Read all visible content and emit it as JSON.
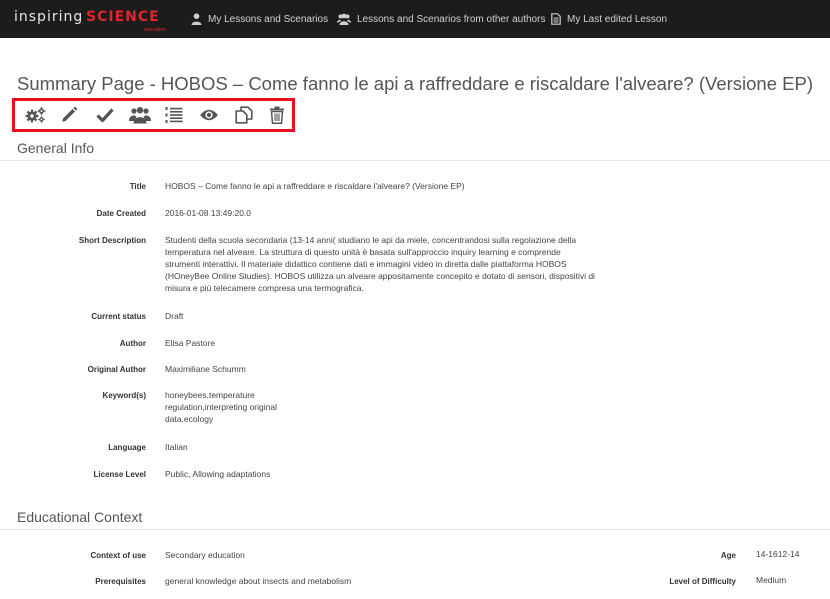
{
  "brand": {
    "word1": "inspiring",
    "word2": "SCIENCE",
    "tagline": "education"
  },
  "nav": [
    {
      "label": "My Lessons and Scenarios",
      "icon": "user-icon"
    },
    {
      "label": "Lessons and Scenarios from other authors",
      "icon": "users-icon"
    },
    {
      "label": "My Last edited Lesson",
      "icon": "document-icon"
    }
  ],
  "page_title": "Summary Page - HOBOS – Come fanno le api a raffreddare e riscaldare l'alveare? (Versione EP)",
  "toolbar": {
    "highlight_color": "#e8101c",
    "icons": [
      "settings-gears-icon",
      "pencil-edit-icon",
      "checkmark-icon",
      "users-group-icon",
      "numbered-list-icon",
      "eye-preview-icon",
      "copy-icon",
      "trash-icon"
    ]
  },
  "general_info": {
    "title": "General Info",
    "fields": [
      {
        "label": "Title",
        "value": "HOBOS – Come fanno le api a raffreddare e riscaldare l'alveare? (Versione EP)"
      },
      {
        "label": "Date Created",
        "value": "2016-01-08 13:49:20.0"
      },
      {
        "label": "Short Description",
        "value": "Studenti della scuola secondaria (13-14 anni( studiano le api da miele, concentrandosi sulla regolazione della temperatura nel alveare. La struttura di questo unità è basata sull'approccio inquiry learning e comprende strumenti interattivi. Il materiale didattico contiene dati e immagini video in diretta dalle piattaforma HOBOS (HOneyBee Online Studies). HOBOS utilizza un alveare appositamente concepito e dotato di sensori, dispositivi di misura e più telecamere compresa una termografica."
      },
      {
        "label": "Current status",
        "value": "Draft"
      },
      {
        "label": "Author",
        "value": "Elisa Pastore"
      },
      {
        "label": "Original Author",
        "value": "Maximiliane Schumm"
      },
      {
        "label": "Keyword(s)",
        "value": "honeybees,temperature regulation,interpreting original data,ecology"
      },
      {
        "label": "Language",
        "value": "Italian"
      },
      {
        "label": "License Level",
        "value": "Public, Allowing adaptations"
      }
    ]
  },
  "educational_context": {
    "title": "Educational Context",
    "left": [
      {
        "label": "Context of use",
        "value": "Secondary education"
      },
      {
        "label": "Prerequisites",
        "value": "general knowledge about insects and metabolism"
      }
    ],
    "right": [
      {
        "label": "Age",
        "value": "14-1612-14"
      },
      {
        "label": "Level of Difficulty",
        "value": "Medium"
      }
    ]
  }
}
